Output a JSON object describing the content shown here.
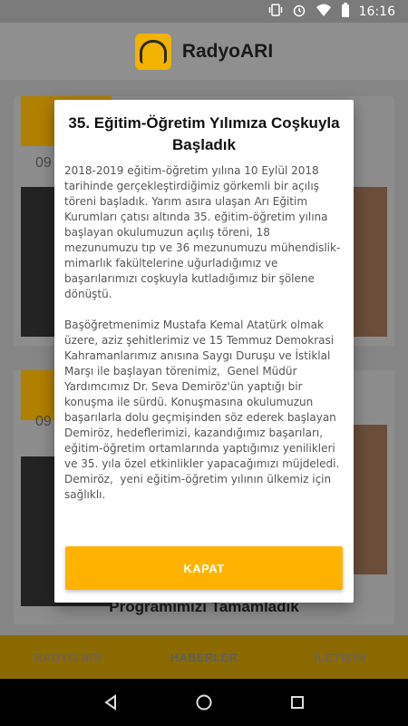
{
  "status_bar": {
    "time": "16:16",
    "icons": [
      "vibrate-icon",
      "alarm-icon",
      "wifi-icon",
      "battery-icon"
    ]
  },
  "app_bar": {
    "title": "RadyoARI",
    "logo_color": "#f2b200"
  },
  "background": {
    "cards": [
      {
        "date": "09"
      },
      {
        "date": "09"
      }
    ],
    "bottom_title_line1": "N                                    k",
    "bottom_title_line2": "Programımızı Tamamladık"
  },
  "bottom_nav": {
    "items": [
      {
        "label": "RADYO ARI"
      },
      {
        "label": "HABERLER"
      },
      {
        "label": "İLETİŞİM"
      }
    ],
    "active_index": 1
  },
  "dialog": {
    "title": "35. Eğitim-Öğretim Yılımıza Coşkuyla Başladık",
    "body": "2018-2019 eğitim-öğretim yılına 10 Eylül 2018 tarihinde gerçekleştirdiğimiz görkemli bir açılış töreni başladık. Yarım asıra ulaşan Arı Eğitim Kurumları çatısı altında 35. eğitim-öğretim yılına başlayan okulumuzun açılış töreni, 18 mezunumuzu tıp ve 36 mezunumuzu mühendislik-mimarlık fakültelerine uğurladığımız ve başarılarımızı coşkuyla kutladığımız bir şölene dönüştü.\n\nBaşöğretmenimiz Mustafa Kemal Atatürk olmak üzere, aziz şehitlerimiz ve 15 Temmuz Demokrasi Kahramanlarımız anısına Saygı Duruşu ve İstiklal Marşı ile başlayan törenimiz,  Genel Müdür Yardımcımız Dr. Seva Demiröz'ün yaptığı bir konuşma ile sürdü. Konuşmasına okulumuzun başarılarla dolu geçmişinden söz ederek başlayan Demiröz, hedeflerimizi, kazandığımız başarıları, eğitim-öğretim ortamlarında yaptığımız yenilikleri ve 35. yıla özel etkinlikler yapacağımızı müjdeledi. Demiröz,  yeni eğitim-öğretim yılının ülkemiz için sağlıklı.",
    "close_button": "KAPAT",
    "accent_color": "#ffb300"
  }
}
